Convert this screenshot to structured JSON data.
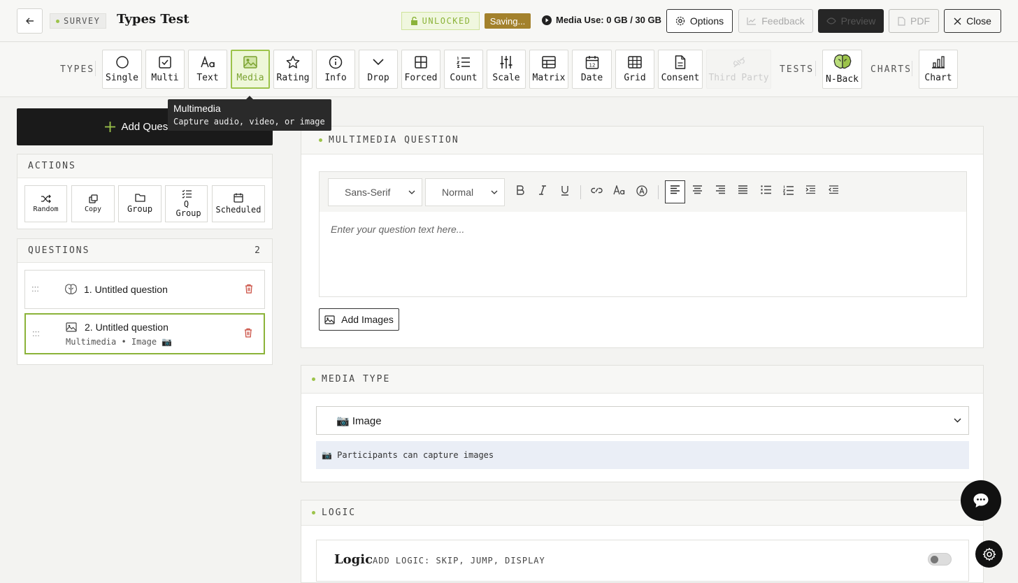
{
  "header": {
    "survey_badge": "SURVEY",
    "title": "Types Test",
    "unlocked": "UNLOCKED",
    "saving": "Saving...",
    "media_use": "Media Use: 0 GB / 30 GB",
    "options": "Options",
    "feedback": "Feedback",
    "preview": "Preview",
    "pdf": "PDF",
    "close": "Close"
  },
  "typesbar": {
    "types_label": "TYPES",
    "tests_label": "TESTS",
    "charts_label": "CHARTS",
    "types": [
      {
        "label": "Single",
        "icon": "circle-icon"
      },
      {
        "label": "Multi",
        "icon": "checkbox-icon"
      },
      {
        "label": "Text",
        "icon": "text-icon"
      },
      {
        "label": "Media",
        "icon": "image-icon"
      },
      {
        "label": "Rating",
        "icon": "star-icon"
      },
      {
        "label": "Info",
        "icon": "info-icon"
      },
      {
        "label": "Drop",
        "icon": "chevron-down-icon"
      },
      {
        "label": "Forced",
        "icon": "grid-icon"
      },
      {
        "label": "Count",
        "icon": "list-ordered-icon"
      },
      {
        "label": "Scale",
        "icon": "sliders-icon"
      },
      {
        "label": "Matrix",
        "icon": "matrix-icon"
      },
      {
        "label": "Date",
        "icon": "calendar-icon"
      },
      {
        "label": "Grid",
        "icon": "table-icon"
      },
      {
        "label": "Consent",
        "icon": "document-icon"
      },
      {
        "label": "Third Party",
        "icon": "plug-icon"
      }
    ],
    "tests": [
      {
        "label": "N-Back",
        "icon": "brain-icon"
      }
    ],
    "charts": [
      {
        "label": "Chart",
        "icon": "bar-chart-icon"
      }
    ]
  },
  "tooltip": {
    "title": "Multimedia",
    "description": "Capture audio, video, or image"
  },
  "sidebar": {
    "add_question": "Add Question",
    "actions_label": "ACTIONS",
    "actions": [
      {
        "label": "Random",
        "icon": "shuffle-icon"
      },
      {
        "label": "Copy",
        "icon": "copy-icon"
      },
      {
        "label": "Group",
        "icon": "folder-icon"
      },
      {
        "label": "Q Group",
        "icon": "checklist-icon"
      },
      {
        "label": "Scheduled",
        "icon": "calendar-icon"
      }
    ],
    "questions_label": "QUESTIONS",
    "questions_count": "2",
    "questions": [
      {
        "title": "1. Untitled question",
        "subtitle": "",
        "icon": "brain-icon"
      },
      {
        "title": "2. Untitled question",
        "subtitle": "Multimedia • Image 📷",
        "icon": "image-icon"
      }
    ]
  },
  "main": {
    "multimedia_header": "MULTIMEDIA QUESTION",
    "font_select": "Sans-Serif",
    "size_select": "Normal",
    "placeholder": "Enter your question text here...",
    "add_images": "Add Images",
    "media_type_header": "MEDIA TYPE",
    "media_type_value": "📷 Image",
    "media_type_info": "📷 Participants can capture images",
    "logic_header": "LOGIC",
    "logic_title": "Logic",
    "logic_subtitle": "ADD LOGIC: SKIP, JUMP, DISPLAY"
  },
  "colors": {
    "accent_green": "#9cc34a",
    "saving_gold": "#a3812c",
    "dark": "#1a1a1a"
  }
}
